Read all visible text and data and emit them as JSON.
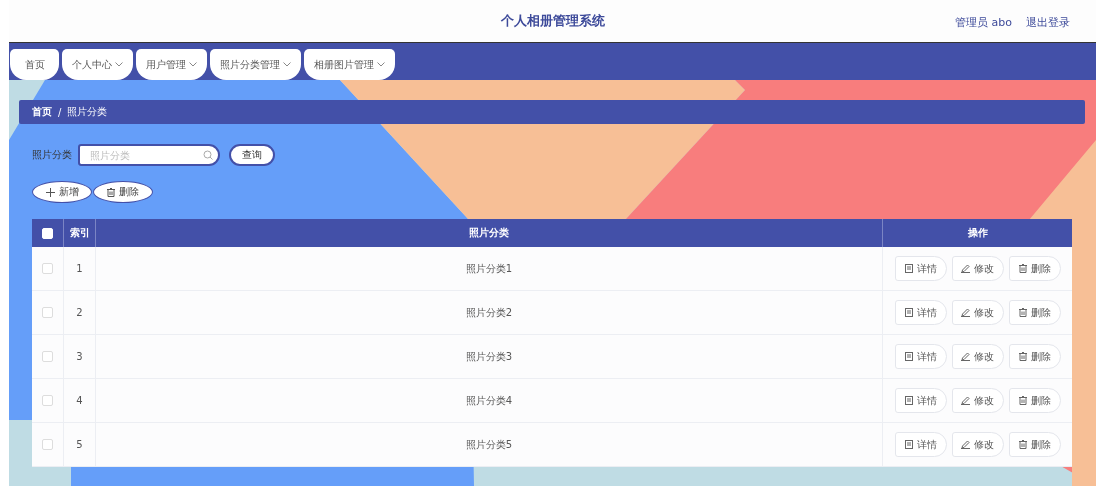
{
  "header": {
    "title": "个人相册管理系统",
    "user": "管理员 abo",
    "logout": "退出登录"
  },
  "nav": [
    {
      "label": "首页",
      "dropdown": false
    },
    {
      "label": "个人中心",
      "dropdown": true
    },
    {
      "label": "用户管理",
      "dropdown": true
    },
    {
      "label": "照片分类管理",
      "dropdown": true
    },
    {
      "label": "相册图片管理",
      "dropdown": true
    }
  ],
  "breadcrumb": {
    "separator": "/",
    "items": [
      "首页",
      "照片分类"
    ]
  },
  "search": {
    "label": "照片分类",
    "placeholder": "照片分类",
    "button": "查询"
  },
  "toolbar": [
    {
      "kind": "add",
      "label": "新增"
    },
    {
      "kind": "delete",
      "label": "删除"
    }
  ],
  "table": {
    "all_checked": false,
    "columns": [
      "索引",
      "照片分类",
      "操作"
    ],
    "rows": [
      {
        "checked": false,
        "index": "1",
        "name": "照片分类1",
        "actions": [
          {
            "kind": "detail",
            "label": "详情"
          },
          {
            "kind": "edit",
            "label": "修改"
          },
          {
            "kind": "delete",
            "label": "删除"
          }
        ]
      },
      {
        "checked": false,
        "index": "2",
        "name": "照片分类2",
        "actions": [
          {
            "kind": "detail",
            "label": "详情"
          },
          {
            "kind": "edit",
            "label": "修改"
          },
          {
            "kind": "delete",
            "label": "删除"
          }
        ]
      },
      {
        "checked": false,
        "index": "3",
        "name": "照片分类3",
        "actions": [
          {
            "kind": "detail",
            "label": "详情"
          },
          {
            "kind": "edit",
            "label": "修改"
          },
          {
            "kind": "delete",
            "label": "删除"
          }
        ]
      },
      {
        "checked": false,
        "index": "4",
        "name": "照片分类4",
        "actions": [
          {
            "kind": "detail",
            "label": "详情"
          },
          {
            "kind": "edit",
            "label": "修改"
          },
          {
            "kind": "delete",
            "label": "删除"
          }
        ]
      },
      {
        "checked": false,
        "index": "5",
        "name": "照片分类5",
        "actions": [
          {
            "kind": "detail",
            "label": "详情"
          },
          {
            "kind": "edit",
            "label": "修改"
          },
          {
            "kind": "delete",
            "label": "删除"
          }
        ]
      }
    ]
  }
}
